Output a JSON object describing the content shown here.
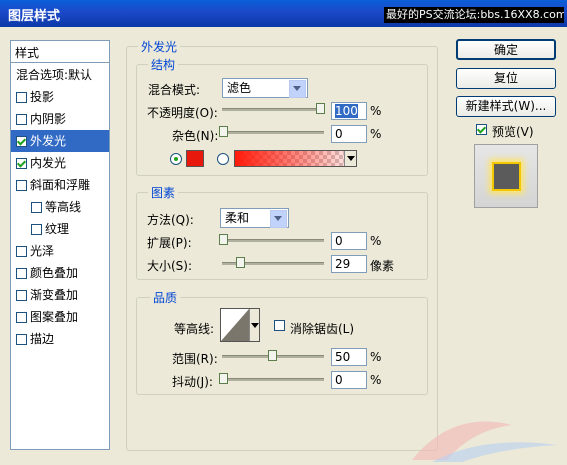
{
  "window": {
    "title": "图层样式",
    "watermark": "最好的PS交流论坛:bbs.16XX8.com"
  },
  "style_list": {
    "header": "样式",
    "items": [
      {
        "label": "混合选项:默认",
        "checkbox": false,
        "checked": false,
        "selected": false
      },
      {
        "label": "投影",
        "checkbox": true,
        "checked": false,
        "selected": false
      },
      {
        "label": "内阴影",
        "checkbox": true,
        "checked": false,
        "selected": false
      },
      {
        "label": "外发光",
        "checkbox": true,
        "checked": true,
        "selected": true
      },
      {
        "label": "内发光",
        "checkbox": true,
        "checked": true,
        "selected": false
      },
      {
        "label": "斜面和浮雕",
        "checkbox": true,
        "checked": false,
        "selected": false
      },
      {
        "label": "等高线",
        "checkbox": true,
        "checked": false,
        "selected": false,
        "sub": true
      },
      {
        "label": "纹理",
        "checkbox": true,
        "checked": false,
        "selected": false,
        "sub": true
      },
      {
        "label": "光泽",
        "checkbox": true,
        "checked": false,
        "selected": false
      },
      {
        "label": "颜色叠加",
        "checkbox": true,
        "checked": false,
        "selected": false
      },
      {
        "label": "渐变叠加",
        "checkbox": true,
        "checked": false,
        "selected": false
      },
      {
        "label": "图案叠加",
        "checkbox": true,
        "checked": false,
        "selected": false
      },
      {
        "label": "描边",
        "checkbox": true,
        "checked": false,
        "selected": false
      }
    ]
  },
  "outer_glow": {
    "title": "外发光",
    "structure": {
      "title": "结构",
      "blend_mode_label": "混合模式:",
      "blend_mode_value": "滤色",
      "opacity_label": "不透明度(O):",
      "opacity_value": "100",
      "opacity_unit": "%",
      "noise_label": "杂色(N):",
      "noise_value": "0",
      "noise_unit": "%",
      "color": "#e8180c"
    },
    "elements": {
      "title": "图素",
      "technique_label": "方法(Q):",
      "technique_value": "柔和",
      "spread_label": "扩展(P):",
      "spread_value": "0",
      "spread_unit": "%",
      "size_label": "大小(S):",
      "size_value": "29",
      "size_unit": "像素"
    },
    "quality": {
      "title": "品质",
      "contour_label": "等高线:",
      "anti_alias_label": "消除锯齿(L)",
      "range_label": "范围(R):",
      "range_value": "50",
      "range_unit": "%",
      "jitter_label": "抖动(J):",
      "jitter_value": "0",
      "jitter_unit": "%"
    }
  },
  "buttons": {
    "ok": "确定",
    "reset": "复位",
    "new_style": "新建样式(W)...",
    "preview": "预览(V)"
  }
}
